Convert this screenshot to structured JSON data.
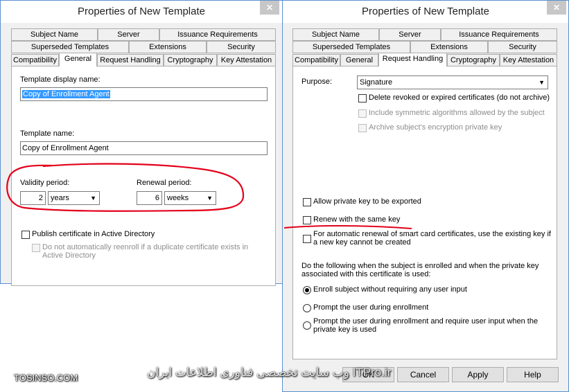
{
  "left_dialog": {
    "title": "Properties of New Template",
    "close_glyph": "✕",
    "tabs_row1": [
      "Subject Name",
      "Server",
      "Issuance Requirements"
    ],
    "tabs_row2": [
      "Superseded Templates",
      "Extensions",
      "Security"
    ],
    "tabs_row3": [
      "Compatibility",
      "General",
      "Request Handling",
      "Cryptography",
      "Key Attestation"
    ],
    "active_tab": "General",
    "display_name_label": "Template display name:",
    "display_name_value": "Copy of Enrollment Agent",
    "template_name_label": "Template name:",
    "template_name_value": "Copy of Enrollment Agent",
    "validity_label": "Validity period:",
    "validity_number": "2",
    "validity_unit": "years",
    "renewal_label": "Renewal period:",
    "renewal_number": "6",
    "renewal_unit": "weeks",
    "publish_ad_label": "Publish certificate in Active Directory",
    "no_reenroll_label": "Do not automatically reenroll if a duplicate certificate exists in Active Directory"
  },
  "right_dialog": {
    "title": "Properties of New Template",
    "close_glyph": "✕",
    "tabs_row1": [
      "Subject Name",
      "Server",
      "Issuance Requirements"
    ],
    "tabs_row2": [
      "Superseded Templates",
      "Extensions",
      "Security"
    ],
    "tabs_row3": [
      "Compatibility",
      "General",
      "Request Handling",
      "Cryptography",
      "Key Attestation"
    ],
    "active_tab": "Request Handling",
    "purpose_label": "Purpose:",
    "purpose_value": "Signature",
    "delete_revoked_label": "Delete revoked or expired certificates (do not archive)",
    "include_symmetric_label": "Include symmetric algorithms allowed by the subject",
    "archive_key_label": "Archive subject's encryption private key",
    "allow_export_label": "Allow private key to be exported",
    "renew_same_key_label": "Renew with the same key",
    "smart_card_label": "For automatic renewal of smart card certificates, use the existing key if a new key cannot be created",
    "subject_enrolled_text": "Do the following when the subject is enrolled and when the private key associated with this certificate is used:",
    "radio_options": [
      "Enroll subject without requiring any user input",
      "Prompt the user during enrollment",
      "Prompt the user during enrollment and require user input when the private key is used"
    ],
    "selected_radio": 0,
    "buttons": {
      "ok": "OK",
      "cancel": "Cancel",
      "apply": "Apply",
      "help": "Help"
    }
  },
  "watermark": {
    "left": "TOSINSO.COM",
    "center": "وب سایت تخصصی فناوری اطلاعات ایران ITPro.ir"
  },
  "colors": {
    "annotation": "#e3001b",
    "selection": "#3399ff",
    "window_border": "#5b8fd0"
  }
}
